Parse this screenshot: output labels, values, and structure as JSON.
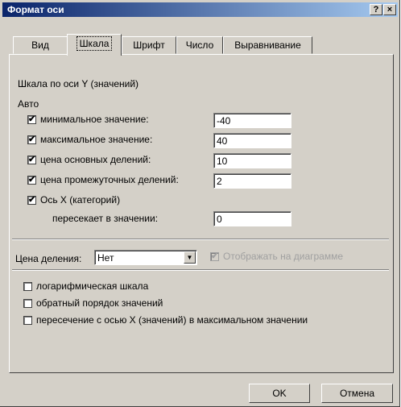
{
  "window": {
    "title": "Формат оси",
    "help_button": "?",
    "close_button": "×"
  },
  "tabs": [
    {
      "label": "Вид",
      "active": false
    },
    {
      "label": "Шкала",
      "active": true
    },
    {
      "label": "Шрифт",
      "active": false
    },
    {
      "label": "Число",
      "active": false
    },
    {
      "label": "Выравнивание",
      "active": false
    }
  ],
  "scale": {
    "heading": "Шкала по оси Y (значений)",
    "auto_label": "Авто",
    "min": {
      "label": "минимальное значение:",
      "checked": true,
      "value": "-40"
    },
    "max": {
      "label": "максимальное значение:",
      "checked": true,
      "value": "40"
    },
    "major": {
      "label": "цена основных делений:",
      "checked": true,
      "value": "10"
    },
    "minor": {
      "label": "цена промежуточных делений:",
      "checked": true,
      "value": "2"
    },
    "crosses": {
      "label": "Ось X (категорий)",
      "checked": true,
      "sub_label": "пересекает в значении:",
      "value": "0"
    }
  },
  "division": {
    "label": "Цена деления:",
    "selected": "Нет",
    "show_label": "Отображать на диаграмме",
    "show_checked": true,
    "show_disabled": true
  },
  "options": [
    {
      "label": "логарифмическая шкала",
      "checked": false
    },
    {
      "label": "обратный порядок значений",
      "checked": false
    },
    {
      "label": "пересечение с осью X (значений) в максимальном значении",
      "checked": false
    }
  ],
  "buttons": {
    "ok": "OK",
    "cancel": "Отмена"
  },
  "check_mark": "✔",
  "dropdown_arrow": "▼"
}
